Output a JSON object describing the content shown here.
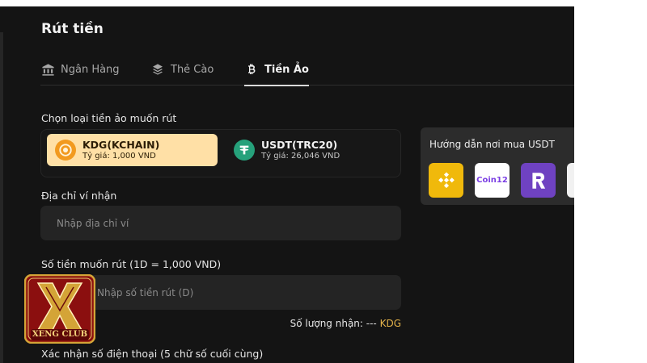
{
  "page": {
    "title": "Rút tiền"
  },
  "tabs": [
    {
      "label": "Ngân Hàng",
      "icon": "bank-icon"
    },
    {
      "label": "Thẻ Cào",
      "icon": "card-stack-icon"
    },
    {
      "label": "Tiền Ảo",
      "icon": "bitcoin-icon",
      "active": true
    }
  ],
  "crypto": {
    "select_label": "Chọn loại tiền ảo muốn rút",
    "options": [
      {
        "name": "KDG(KCHAIN)",
        "rate": "Tỷ giá: 1,000 VND",
        "icon": "kdg-coin-icon",
        "color": "#f29a1f",
        "selected": true
      },
      {
        "name": "USDT(TRC20)",
        "rate": "Tỷ giá: 26,046 VND",
        "icon": "tether-icon",
        "color": "#26a17b",
        "selected": false
      }
    ]
  },
  "wallet": {
    "label": "Địa chỉ ví nhận",
    "placeholder": "Nhập địa chỉ ví"
  },
  "amount": {
    "label": "Số tiền muốn rút (1D = 1,000 VND)",
    "placeholder": "Nhập số tiền rút (D)"
  },
  "receive": {
    "prefix": "Số lượng nhận: --- ",
    "unit": "KDG"
  },
  "phone": {
    "label": "Xác nhận số điện thoại (5 chữ số cuối cùng)"
  },
  "guide": {
    "title": "Hướng dẫn nơi mua USDT",
    "exchanges": [
      {
        "name": "binance-logo",
        "color": "#f0b90b"
      },
      {
        "label": "Coin12",
        "color": "#7b3fe4"
      },
      {
        "name": "remitano-logo",
        "color": "#6f42c1"
      },
      {
        "name": "partially-visible-logo"
      }
    ]
  },
  "brand": {
    "logo_text": "XENG CLUB",
    "accent": "#d4a437",
    "primary": "#8b0f0f"
  }
}
